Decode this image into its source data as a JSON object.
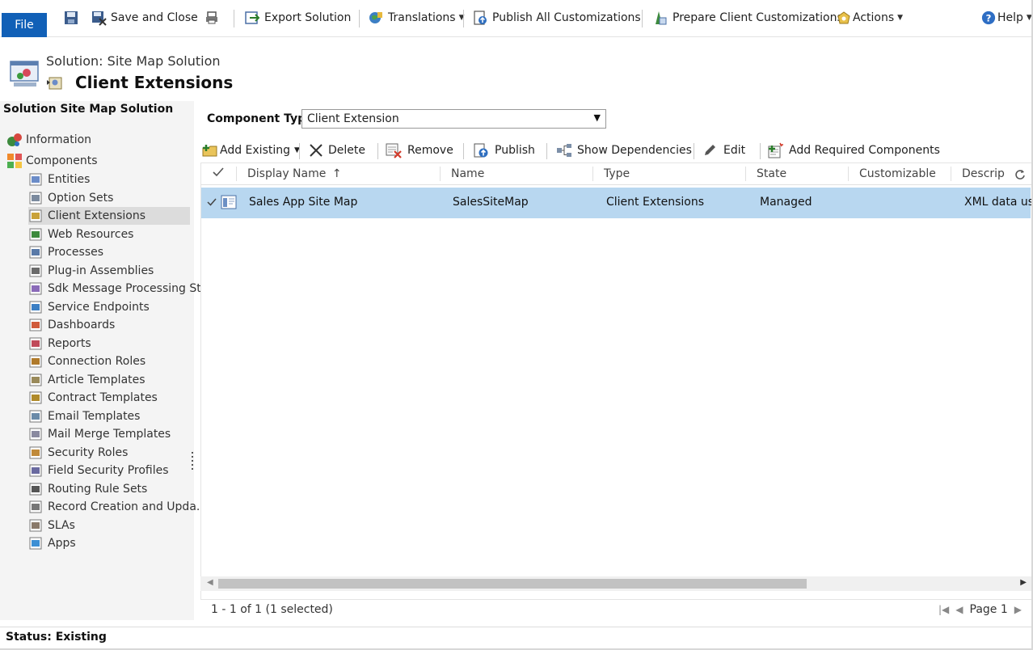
{
  "ribbon": {
    "file_label": "File",
    "save_close_label": "Save and Close",
    "export_label": "Export Solution",
    "translations_label": "Translations",
    "publish_all_label": "Publish All Customizations",
    "prepare_label": "Prepare Client Customizations",
    "actions_label": "Actions",
    "help_label": "Help"
  },
  "header": {
    "solution_label": "Solution: Site Map Solution",
    "title": "Client Extensions"
  },
  "sidebar": {
    "heading": "Solution Site Map Solution",
    "information": "Information",
    "components": "Components",
    "items": [
      {
        "label": "Entities",
        "icon": "entities-icon"
      },
      {
        "label": "Option Sets",
        "icon": "option-sets-icon"
      },
      {
        "label": "Client Extensions",
        "icon": "client-extensions-icon",
        "selected": true
      },
      {
        "label": "Web Resources",
        "icon": "web-resources-icon"
      },
      {
        "label": "Processes",
        "icon": "processes-icon"
      },
      {
        "label": "Plug-in Assemblies",
        "icon": "plugin-icon"
      },
      {
        "label": "Sdk Message Processing St...",
        "icon": "sdk-icon"
      },
      {
        "label": "Service Endpoints",
        "icon": "globe-icon"
      },
      {
        "label": "Dashboards",
        "icon": "dashboard-icon"
      },
      {
        "label": "Reports",
        "icon": "report-icon"
      },
      {
        "label": "Connection Roles",
        "icon": "connection-roles-icon"
      },
      {
        "label": "Article Templates",
        "icon": "article-template-icon"
      },
      {
        "label": "Contract Templates",
        "icon": "contract-template-icon"
      },
      {
        "label": "Email Templates",
        "icon": "email-template-icon"
      },
      {
        "label": "Mail Merge Templates",
        "icon": "mail-merge-icon"
      },
      {
        "label": "Security Roles",
        "icon": "security-roles-icon"
      },
      {
        "label": "Field Security Profiles",
        "icon": "field-security-icon"
      },
      {
        "label": "Routing Rule Sets",
        "icon": "routing-icon"
      },
      {
        "label": "Record Creation and Upda...",
        "icon": "gear-icon"
      },
      {
        "label": "SLAs",
        "icon": "sla-icon"
      },
      {
        "label": "Apps",
        "icon": "apps-icon"
      }
    ]
  },
  "main": {
    "component_type_label": "Component Type",
    "component_type_value": "Client Extension",
    "toolbar": {
      "add_existing": "Add Existing",
      "delete": "Delete",
      "remove": "Remove",
      "publish": "Publish",
      "show_dependencies": "Show Dependencies",
      "edit": "Edit",
      "add_required": "Add Required Components"
    },
    "columns": [
      "Display Name",
      "Name",
      "Type",
      "State",
      "Customizable",
      "Descrip"
    ],
    "sort_arrow": "↑",
    "rows": [
      {
        "display_name": "Sales App Site Map",
        "name": "SalesSiteMap",
        "type": "Client Extensions",
        "state": "Managed",
        "customizable": "",
        "description": "XML data use"
      }
    ],
    "record_count": "1 - 1 of 1 (1 selected)",
    "page_label": "Page 1"
  },
  "status": {
    "text": "Status: Existing"
  },
  "colors": {
    "file_button": "#1160b7",
    "selected_row": "#b8d7f0",
    "nav_bg": "#f4f4f4"
  }
}
